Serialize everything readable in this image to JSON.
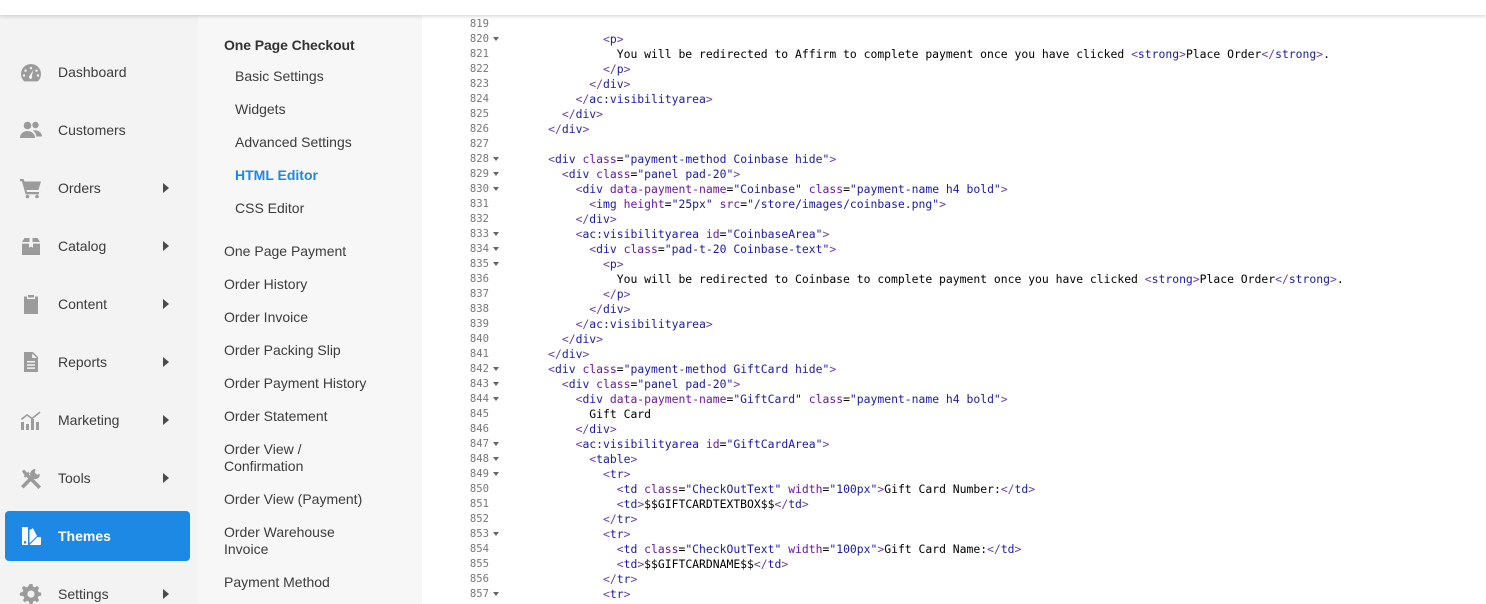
{
  "nav": {
    "items": [
      {
        "label": "Dashboard",
        "icon": "dashboard-icon",
        "arrow": false,
        "active": false
      },
      {
        "label": "Customers",
        "icon": "customers-icon",
        "arrow": false,
        "active": false
      },
      {
        "label": "Orders",
        "icon": "cart-icon",
        "arrow": true,
        "active": false
      },
      {
        "label": "Catalog",
        "icon": "box-icon",
        "arrow": true,
        "active": false
      },
      {
        "label": "Content",
        "icon": "clipboard-icon",
        "arrow": true,
        "active": false
      },
      {
        "label": "Reports",
        "icon": "document-icon",
        "arrow": true,
        "active": false
      },
      {
        "label": "Marketing",
        "icon": "chart-icon",
        "arrow": true,
        "active": false
      },
      {
        "label": "Tools",
        "icon": "tools-icon",
        "arrow": true,
        "active": false
      },
      {
        "label": "Themes",
        "icon": "themes-icon",
        "arrow": false,
        "active": true
      },
      {
        "label": "Settings",
        "icon": "gear-icon",
        "arrow": true,
        "active": false
      }
    ]
  },
  "subnav": {
    "heading": "One Page Checkout",
    "children": [
      "Basic Settings",
      "Widgets",
      "Advanced Settings",
      "HTML Editor",
      "CSS Editor"
    ],
    "current": "HTML Editor",
    "links": [
      "One Page Payment",
      "Order History",
      "Order Invoice",
      "Order Packing Slip",
      "Order Payment History",
      "Order Statement",
      "Order View / Confirmation",
      "Order View (Payment)",
      "Order Warehouse Invoice",
      "Payment Method"
    ]
  },
  "editor": {
    "lines": [
      {
        "n": "819",
        "fold": false,
        "code": ""
      },
      {
        "n": "820",
        "fold": true,
        "code": "              <p>"
      },
      {
        "n": "821",
        "fold": false,
        "code": "                You will be redirected to Affirm to complete payment once you have clicked <strong>Place Order</strong>."
      },
      {
        "n": "822",
        "fold": false,
        "code": "              </p>"
      },
      {
        "n": "823",
        "fold": false,
        "code": "            </div>"
      },
      {
        "n": "824",
        "fold": false,
        "code": "          </ac:visibilityarea>"
      },
      {
        "n": "825",
        "fold": false,
        "code": "        </div>"
      },
      {
        "n": "826",
        "fold": false,
        "code": "      </div>"
      },
      {
        "n": "827",
        "fold": false,
        "code": ""
      },
      {
        "n": "828",
        "fold": true,
        "code": "      <div class=\"payment-method Coinbase hide\">"
      },
      {
        "n": "829",
        "fold": true,
        "code": "        <div class=\"panel pad-20\">"
      },
      {
        "n": "830",
        "fold": true,
        "code": "          <div data-payment-name=\"Coinbase\" class=\"payment-name h4 bold\">"
      },
      {
        "n": "831",
        "fold": false,
        "code": "            <img height=\"25px\" src=\"/store/images/coinbase.png\">"
      },
      {
        "n": "832",
        "fold": false,
        "code": "          </div>"
      },
      {
        "n": "833",
        "fold": true,
        "code": "          <ac:visibilityarea id=\"CoinbaseArea\">"
      },
      {
        "n": "834",
        "fold": true,
        "code": "            <div class=\"pad-t-20 Coinbase-text\">"
      },
      {
        "n": "835",
        "fold": true,
        "code": "              <p>"
      },
      {
        "n": "836",
        "fold": false,
        "code": "                You will be redirected to Coinbase to complete payment once you have clicked <strong>Place Order</strong>."
      },
      {
        "n": "837",
        "fold": false,
        "code": "              </p>"
      },
      {
        "n": "838",
        "fold": false,
        "code": "            </div>"
      },
      {
        "n": "839",
        "fold": false,
        "code": "          </ac:visibilityarea>"
      },
      {
        "n": "840",
        "fold": false,
        "code": "        </div>"
      },
      {
        "n": "841",
        "fold": false,
        "code": "      </div>"
      },
      {
        "n": "842",
        "fold": true,
        "code": "      <div class=\"payment-method GiftCard hide\">"
      },
      {
        "n": "843",
        "fold": true,
        "code": "        <div class=\"panel pad-20\">"
      },
      {
        "n": "844",
        "fold": true,
        "code": "          <div data-payment-name=\"GiftCard\" class=\"payment-name h4 bold\">"
      },
      {
        "n": "845",
        "fold": false,
        "code": "            Gift Card"
      },
      {
        "n": "846",
        "fold": false,
        "code": "          </div>"
      },
      {
        "n": "847",
        "fold": true,
        "code": "          <ac:visibilityarea id=\"GiftCardArea\">"
      },
      {
        "n": "848",
        "fold": true,
        "code": "            <table>"
      },
      {
        "n": "849",
        "fold": true,
        "code": "              <tr>"
      },
      {
        "n": "850",
        "fold": false,
        "code": "                <td class=\"CheckOutText\" width=\"100px\">Gift Card Number:</td>"
      },
      {
        "n": "851",
        "fold": false,
        "code": "                <td>$$GIFTCARDTEXTBOX$$</td>"
      },
      {
        "n": "852",
        "fold": false,
        "code": "              </tr>"
      },
      {
        "n": "853",
        "fold": true,
        "code": "              <tr>"
      },
      {
        "n": "854",
        "fold": false,
        "code": "                <td class=\"CheckOutText\" width=\"100px\">Gift Card Name:</td>"
      },
      {
        "n": "855",
        "fold": false,
        "code": "                <td>$$GIFTCARDNAME$$</td>"
      },
      {
        "n": "856",
        "fold": false,
        "code": "              </tr>"
      },
      {
        "n": "857",
        "fold": true,
        "code": "              <tr>"
      }
    ]
  }
}
